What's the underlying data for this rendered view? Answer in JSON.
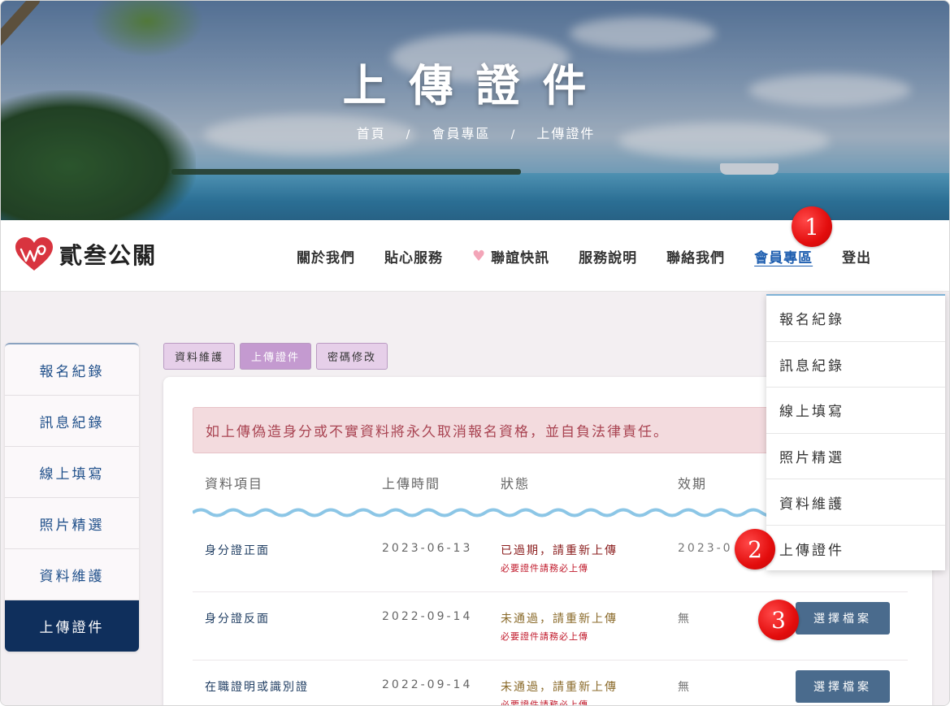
{
  "hero": {
    "title": "上傳證件",
    "breadcrumb": [
      "首頁",
      "會員專區",
      "上傳證件"
    ],
    "breadcrumb_sep": "/"
  },
  "navbar": {
    "logo_text": "貳叁公關",
    "items": [
      {
        "label": "關於我們"
      },
      {
        "label": "貼心服務"
      },
      {
        "label": "聯誼快訊",
        "icon": "heart-icon"
      },
      {
        "label": "服務說明"
      },
      {
        "label": "聯絡我們"
      },
      {
        "label": "會員專區",
        "active": true
      },
      {
        "label": "登出"
      }
    ],
    "active_color": "#1f5fb0"
  },
  "sidebar": {
    "items": [
      {
        "label": "報名紀錄"
      },
      {
        "label": "訊息紀錄"
      },
      {
        "label": "線上填寫"
      },
      {
        "label": "照片精選"
      },
      {
        "label": "資料維護"
      },
      {
        "label": "上傳證件",
        "active": true
      }
    ]
  },
  "tabs": [
    {
      "label": "資料維護"
    },
    {
      "label": "上傳證件",
      "active": true
    },
    {
      "label": "密碼修改"
    }
  ],
  "panel": {
    "alert": "如上傳偽造身分或不實資料將永久取消報名資格，並自負法律責任。",
    "headers": [
      "資料項目",
      "上傳時間",
      "狀態",
      "效期"
    ],
    "rows": [
      {
        "item": "身分證正面",
        "date": "2023-06-13",
        "status": "已過期，請重新上傳",
        "note": "必要證件請務必上傳",
        "expiry": "2023-0"
      },
      {
        "item": "身分證反面",
        "date": "2022-09-14",
        "status": "未通過，請重新上傳",
        "note": "必要證件請務必上傳",
        "expiry": "無",
        "button": "選擇檔案"
      },
      {
        "item": "在職證明或識別證",
        "date": "2022-09-14",
        "status": "未通過，請重新上傳",
        "note": "必要證件請務必上傳",
        "expiry": "無",
        "button": "選擇檔案"
      }
    ]
  },
  "dropdown": {
    "items": [
      "報名紀錄",
      "訊息紀錄",
      "線上填寫",
      "照片精選",
      "資料維護",
      "上傳證件"
    ]
  },
  "markers": [
    "1",
    "2",
    "3"
  ]
}
